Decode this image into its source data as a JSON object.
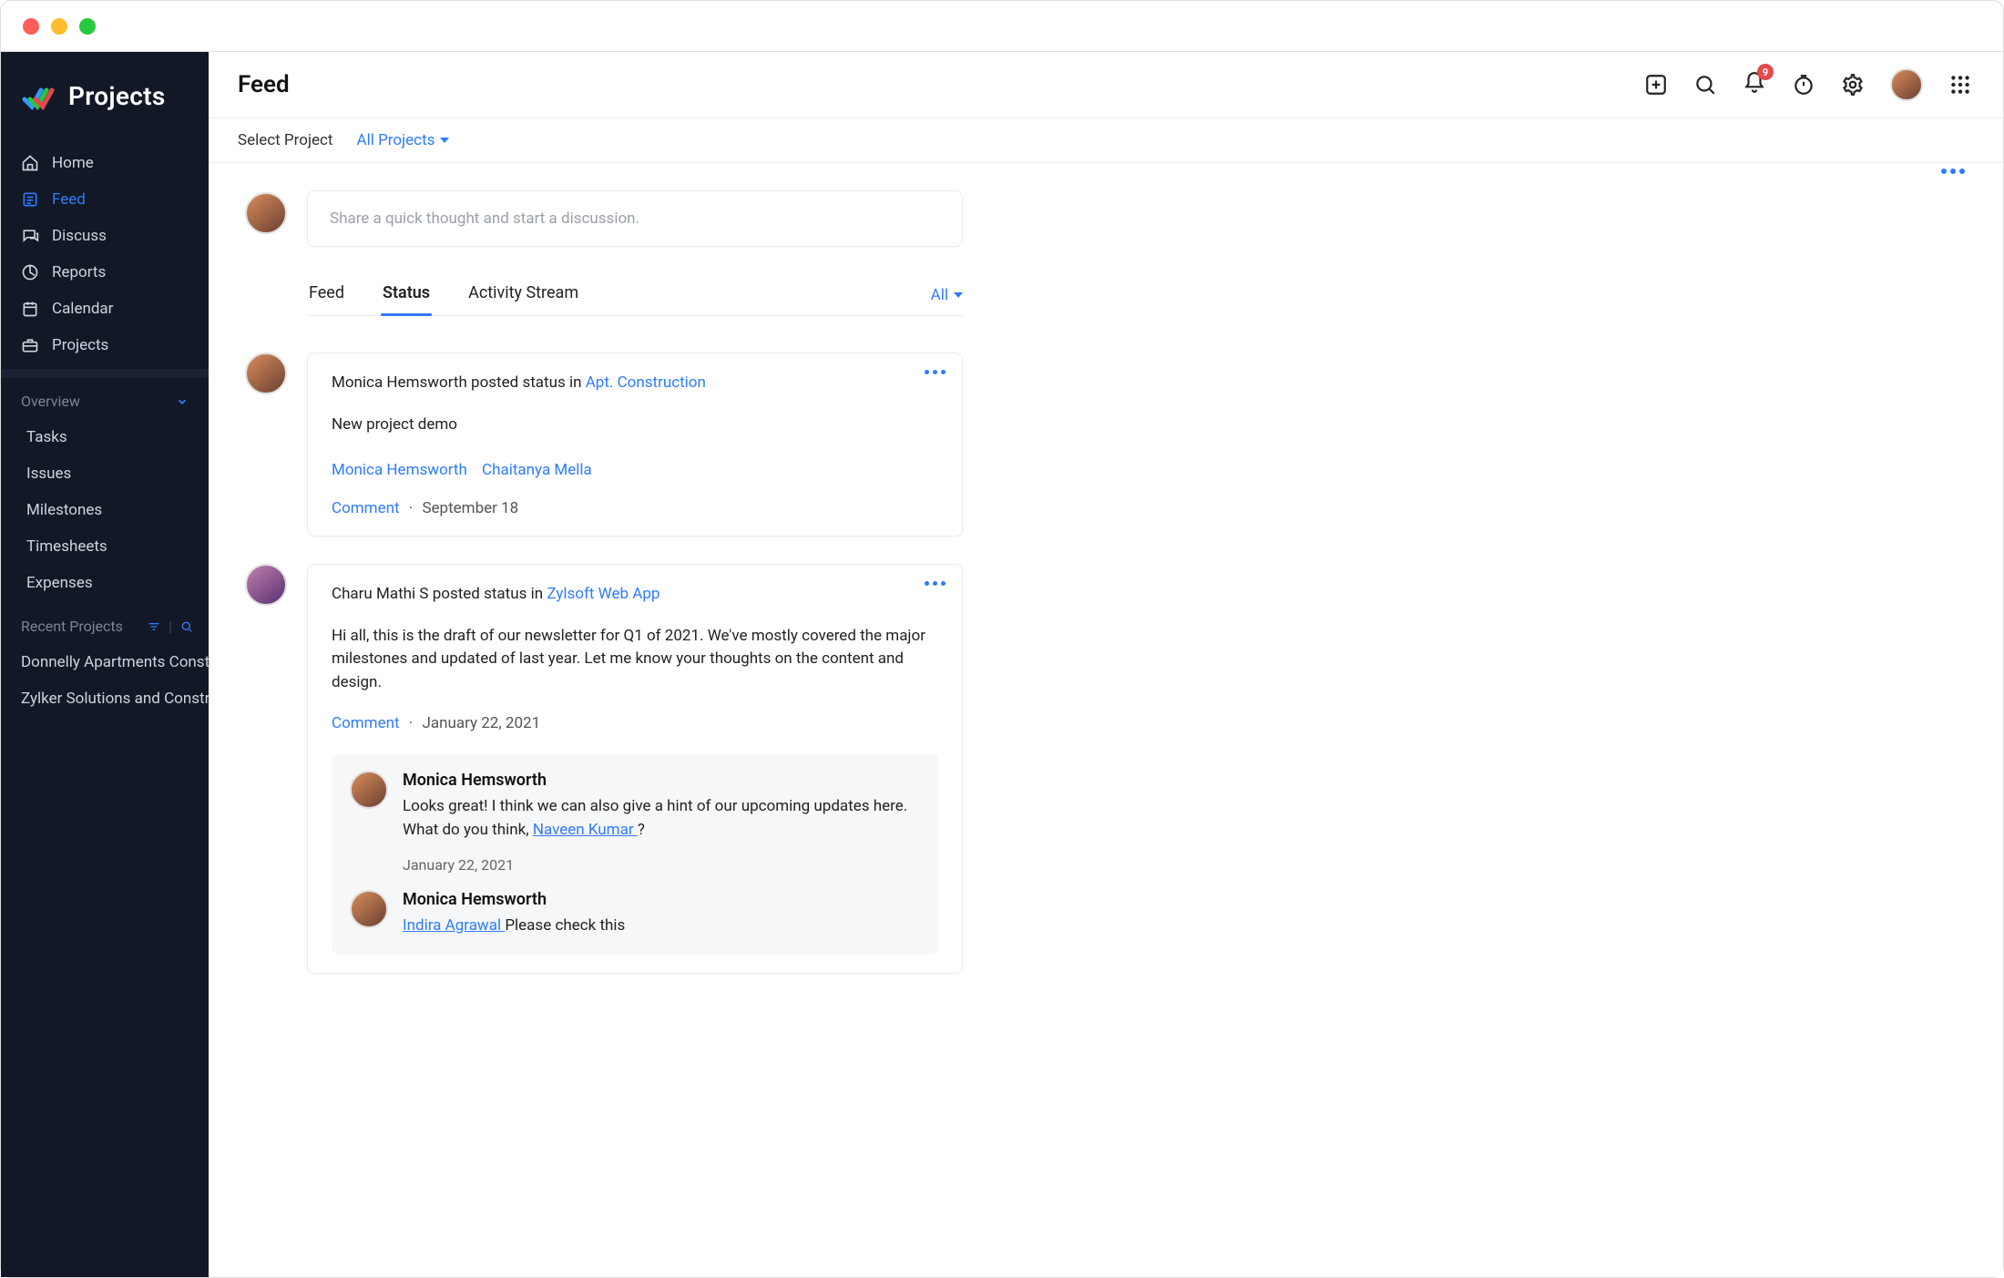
{
  "brand": {
    "name": "Projects"
  },
  "sidebar": {
    "items": [
      {
        "label": "Home"
      },
      {
        "label": "Feed"
      },
      {
        "label": "Discuss"
      },
      {
        "label": "Reports"
      },
      {
        "label": "Calendar"
      },
      {
        "label": "Projects"
      }
    ],
    "overview": {
      "title": "Overview",
      "items": [
        {
          "label": "Tasks"
        },
        {
          "label": "Issues"
        },
        {
          "label": "Milestones"
        },
        {
          "label": "Timesheets"
        },
        {
          "label": "Expenses"
        }
      ]
    },
    "recent": {
      "title": "Recent Projects",
      "items": [
        {
          "label": "Donnelly Apartments Const"
        },
        {
          "label": "Zylker Solutions and Constr"
        }
      ]
    }
  },
  "header": {
    "title": "Feed",
    "notification_count": "9"
  },
  "filterbar": {
    "label": "Select Project",
    "value": "All Projects"
  },
  "compose": {
    "placeholder": "Share a quick thought and start a discussion."
  },
  "tabs": [
    {
      "label": "Feed"
    },
    {
      "label": "Status"
    },
    {
      "label": "Activity Stream"
    }
  ],
  "filter_dropdown": "All",
  "posts": [
    {
      "author": "Monica Hemsworth",
      "verb": "posted status in",
      "target": "Apt. Construction",
      "body": "New project demo",
      "tagged": [
        "Monica Hemsworth",
        "Chaitanya Mella"
      ],
      "comment_label": "Comment",
      "date": "September 18"
    },
    {
      "author": "Charu Mathi S",
      "verb": "posted status in",
      "target": "Zylsoft Web App",
      "body": "Hi all, this is the draft of our newsletter for Q1 of 2021. We've mostly covered the major milestones and updated of last year. Let me know your thoughts on the content and design.",
      "comment_label": "Comment",
      "date": "January 22, 2021",
      "replies": [
        {
          "author": "Monica Hemsworth",
          "text_before": "Looks great! I think we can also give a hint of our upcoming updates here. What do you think, ",
          "mention": "Naveen Kumar ",
          "text_after": "?",
          "date": "January 22, 2021"
        },
        {
          "author": "Monica Hemsworth",
          "mention": "Indira Agrawal ",
          "text_after": "Please check this"
        }
      ]
    }
  ]
}
